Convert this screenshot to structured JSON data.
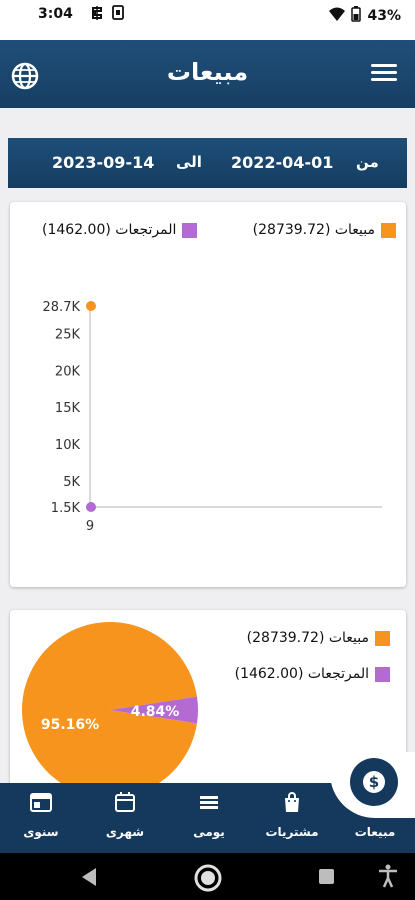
{
  "status": {
    "time": "3:04",
    "battery": "43%"
  },
  "app_bar": {
    "title": "مبيعات"
  },
  "date_range": {
    "from_label": "من",
    "from_date": "2022-04-01",
    "to_label": "الى",
    "to_date": "2023-09-14"
  },
  "colors": {
    "sales": "#f7941d",
    "returns": "#b36ad1",
    "primary": "#173e63"
  },
  "legend": {
    "sales": "مبيعات (28739.72)",
    "returns": "المرتجعات (1462.00)"
  },
  "chart_data": [
    {
      "type": "line",
      "x_ticks": [
        "9"
      ],
      "y_ticks": [
        "28.7K",
        "25K",
        "20K",
        "15K",
        "10K",
        "5K",
        "1.5K"
      ],
      "series": [
        {
          "name": "مبيعات (28739.72)",
          "x": [
            "9"
          ],
          "y": [
            28739.72
          ],
          "color": "#f7941d"
        },
        {
          "name": "المرتجعات (1462.00)",
          "x": [
            "9"
          ],
          "y": [
            1462.0
          ],
          "color": "#b36ad1"
        }
      ],
      "ylim": [
        1462.0,
        28739.72
      ]
    },
    {
      "type": "pie",
      "slices": [
        {
          "name": "مبيعات (28739.72)",
          "value": 95.16,
          "label": "95.16%",
          "color": "#f7941d"
        },
        {
          "name": "المرتجعات (1462.00)",
          "value": 4.84,
          "label": "4.84%",
          "color": "#b36ad1"
        }
      ]
    }
  ],
  "bottom_nav": {
    "items": [
      {
        "label": "مبيعات",
        "icon": "dollar-icon"
      },
      {
        "label": "مشتريات",
        "icon": "shopping-bag-icon"
      },
      {
        "label": "يومى",
        "icon": "list-icon"
      },
      {
        "label": "شهرى",
        "icon": "calendar-icon"
      },
      {
        "label": "سنوى",
        "icon": "calendar-year-icon"
      }
    ]
  }
}
